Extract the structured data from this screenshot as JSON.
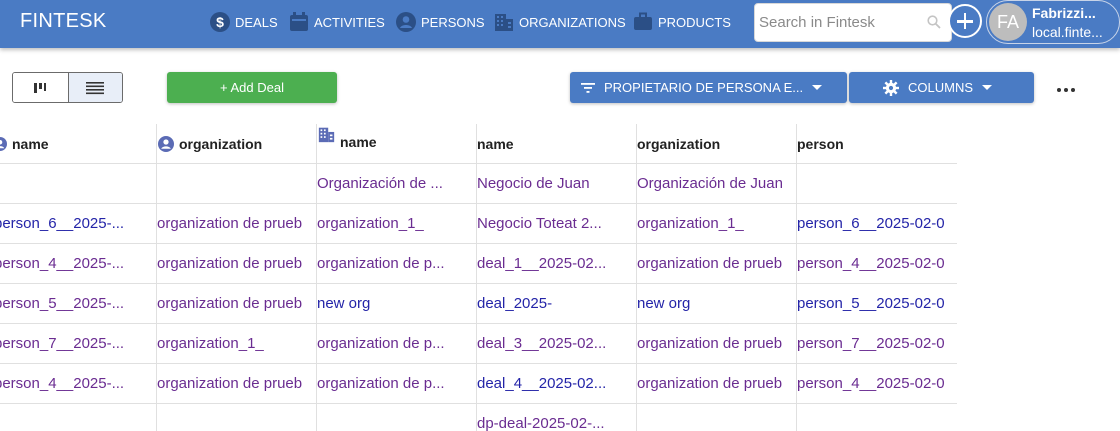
{
  "app": {
    "brand": "FINTESK"
  },
  "nav": [
    {
      "label": "DEALS",
      "icon": "dollar-icon"
    },
    {
      "label": "ACTIVITIES",
      "icon": "calendar-icon"
    },
    {
      "label": "PERSONS",
      "icon": "person-icon"
    },
    {
      "label": "ORGANIZATIONS",
      "icon": "building-icon"
    },
    {
      "label": "PRODUCTS",
      "icon": "briefcase-icon"
    }
  ],
  "search": {
    "placeholder": "Search in Fintesk",
    "value": ""
  },
  "user": {
    "initials": "FA",
    "name": "Fabrizzi...",
    "host": "local.finte..."
  },
  "toolbar": {
    "add_deal_label": "+ Add Deal",
    "filter_label": "PROPIETARIO DE PERSONA E...",
    "columns_label": "COLUMNS"
  },
  "colors": {
    "primary": "#4a7bc4",
    "success": "#4caf50",
    "link_purple": "#6a2c91",
    "link_blue": "#2424a8"
  },
  "table": {
    "headers": [
      {
        "label": "name",
        "icon": "person-icon"
      },
      {
        "label": "organization",
        "icon": "person-icon"
      },
      {
        "label": "name",
        "icon": "building-icon"
      },
      {
        "label": "name",
        "icon": ""
      },
      {
        "label": "organization",
        "icon": ""
      },
      {
        "label": "person",
        "icon": ""
      }
    ],
    "rows": [
      [
        "",
        "",
        "Organización de ...",
        "Negocio de Juan",
        "Organización de Juan",
        ""
      ],
      [
        "person_6__2025-...",
        "organization de prueb",
        "organization_1_",
        "Negocio Toteat 2...",
        "organization_1_",
        "person_6__2025-02-0"
      ],
      [
        "person_4__2025-...",
        "organization de prueb",
        "organization de p...",
        "deal_1__2025-02...",
        "organization de prueb",
        "person_4__2025-02-0"
      ],
      [
        "person_5__2025-...",
        "organization de prueb",
        "new org",
        "deal_2025-",
        "new org",
        "person_5__2025-02-0"
      ],
      [
        "person_7__2025-...",
        "organization_1_",
        "organization de p...",
        "deal_3__2025-02...",
        "organization de prueb",
        "person_7__2025-02-0"
      ],
      [
        "person_4__2025-...",
        "organization de prueb",
        "organization de p...",
        "deal_4__2025-02...",
        "organization de prueb",
        "person_4__2025-02-0"
      ],
      [
        "",
        "",
        "",
        "dp-deal-2025-02-...",
        "",
        ""
      ]
    ]
  }
}
